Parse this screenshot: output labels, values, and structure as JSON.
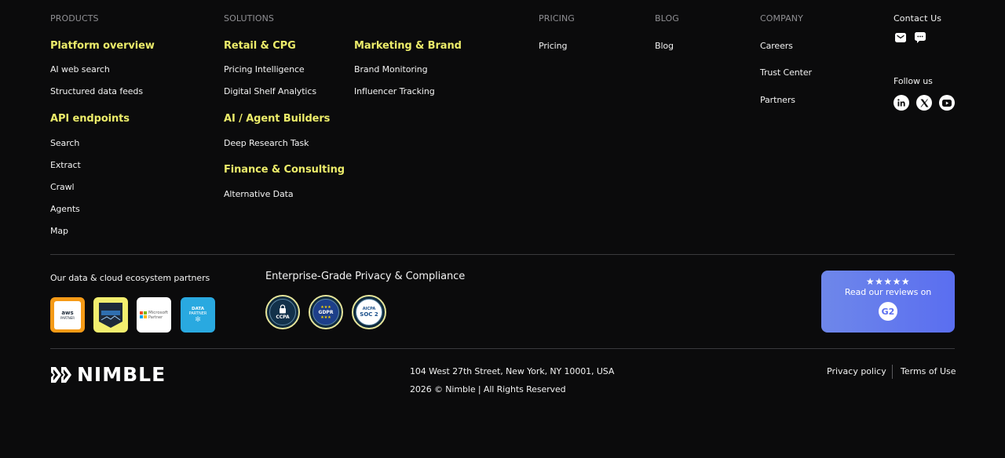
{
  "columns": {
    "products": "PRODUCTS",
    "solutions": "SOLUTIONS",
    "pricing": "PRICING",
    "blog": "BLOG",
    "company": "COMPANY",
    "contact": "Contact Us"
  },
  "products": {
    "platform_title": "Platform overview",
    "platform_items": [
      "AI web search",
      "Structured data feeds"
    ],
    "api_title": "API endpoints",
    "api_items": [
      "Search",
      "Extract",
      "Crawl",
      "Agents",
      "Map"
    ]
  },
  "solutions": {
    "retail_title": "Retail & CPG",
    "retail_items": [
      "Pricing Intelligence",
      "Digital Shelf Analytics"
    ],
    "ai_title": "AI / Agent Builders",
    "ai_items": [
      "Deep Research Task"
    ],
    "finance_title": "Finance & Consulting",
    "finance_items": [
      "Alternative Data"
    ],
    "marketing_title": "Marketing & Brand",
    "marketing_items": [
      "Brand Monitoring",
      "Influencer Tracking"
    ]
  },
  "pricing": {
    "items": [
      "Pricing"
    ]
  },
  "blog": {
    "items": [
      "Blog"
    ]
  },
  "company": {
    "items": [
      "Careers",
      "Trust Center",
      "Partners"
    ]
  },
  "contact": {
    "icons": [
      "mail-icon",
      "chat-icon"
    ],
    "follow_label": "Follow us",
    "socials": [
      "linkedin-icon",
      "x-icon",
      "youtube-icon"
    ]
  },
  "partners": {
    "label": "Our data & cloud ecosystem partners",
    "badges": [
      {
        "name": "aws-partner-badge",
        "text_top": "aws",
        "text_bottom": "PARTNER",
        "bg": "#f59a16"
      },
      {
        "name": "databricks-partner-badge",
        "text_top": "",
        "text_bottom": "",
        "bg": "#f2ee6e"
      },
      {
        "name": "microsoft-partner-badge",
        "text_top": "Microsoft",
        "text_bottom": "Partner",
        "bg": "#ffffff"
      },
      {
        "name": "snowflake-data-partner-badge",
        "text_top": "DATA",
        "text_bottom": "PARTNER",
        "bg": "#29a9e0"
      }
    ]
  },
  "compliance": {
    "label": "Enterprise-Grade Privacy & Compliance",
    "certs": [
      {
        "name": "ccpa-badge",
        "label": "CCPA"
      },
      {
        "name": "gdpr-badge",
        "label": "GDPR"
      },
      {
        "name": "soc2-badge",
        "label_top": "AICPA",
        "label": "SOC 2"
      }
    ]
  },
  "review": {
    "stars": "★★★★★",
    "label": "Read our reviews on",
    "brand": "G2"
  },
  "footer": {
    "logo_text": "NIMBLE",
    "address": "104 West 27th Street, New York, NY 10001, USA",
    "copyright": "2026 © Nimble | All Rights Reserved",
    "privacy": "Privacy policy",
    "terms": "Terms of Use"
  },
  "colors": {
    "background": "#0b0b0c",
    "accent_yellow": "#ecec6a",
    "review_card": "#6a7ff0"
  }
}
